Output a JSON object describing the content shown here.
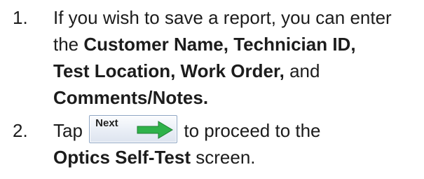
{
  "steps": [
    {
      "number": "1.",
      "lines": [
        {
          "t1": "If you wish to save a report, you can enter"
        },
        {
          "t1": "the ",
          "b1": "Customer Name, Technician ID,"
        },
        {
          "b1": "Test Location, Work Order,",
          "t2": " and"
        },
        {
          "b1": "Comments/Notes."
        }
      ]
    },
    {
      "number": "2.",
      "tap_text": "Tap ",
      "button": {
        "label": "Next",
        "icon": "green-right-arrow-icon",
        "arrow_color": "#2fb24a"
      },
      "after_button_text": " to proceed to the",
      "line2": {
        "b1": "Optics Self-Test",
        "t2": " screen."
      }
    }
  ]
}
